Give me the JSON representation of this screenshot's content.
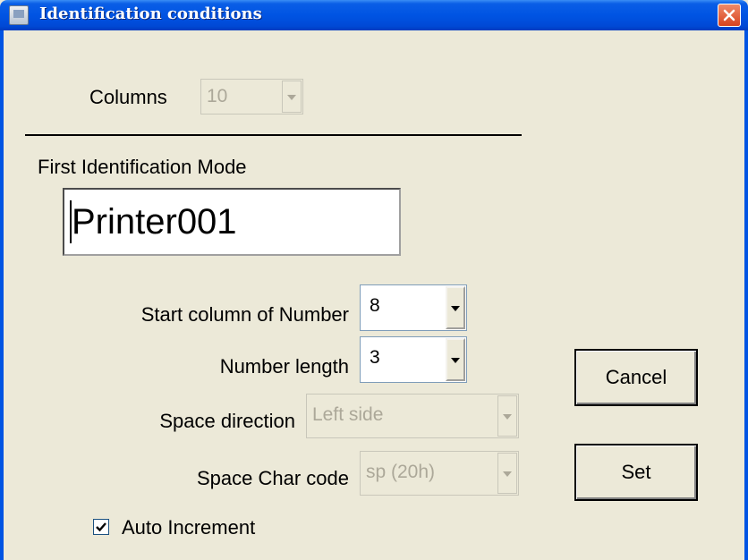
{
  "window": {
    "title": "Identification conditions"
  },
  "columns": {
    "label": "Columns",
    "value": "10"
  },
  "first_mode": {
    "label": "First Identification Mode",
    "value": "Printer001"
  },
  "start_column": {
    "label": "Start column of Number",
    "value": "8"
  },
  "number_length": {
    "label": "Number length",
    "value": "3"
  },
  "space_direction": {
    "label": "Space direction",
    "value": "Left side"
  },
  "space_char": {
    "label": "Space Char code",
    "value": "sp (20h)"
  },
  "auto_increment": {
    "label": "Auto Increment",
    "checked": true
  },
  "buttons": {
    "cancel": "Cancel",
    "set": "Set"
  },
  "colors": {
    "titlebar": "#0054e3",
    "dialog_bg": "#ece9d8",
    "close_button": "#d8421e",
    "disabled_text": "#aca899"
  },
  "icons": [
    "window-app-icon",
    "close-icon",
    "dropdown-arrow-icon",
    "checkmark-icon"
  ]
}
